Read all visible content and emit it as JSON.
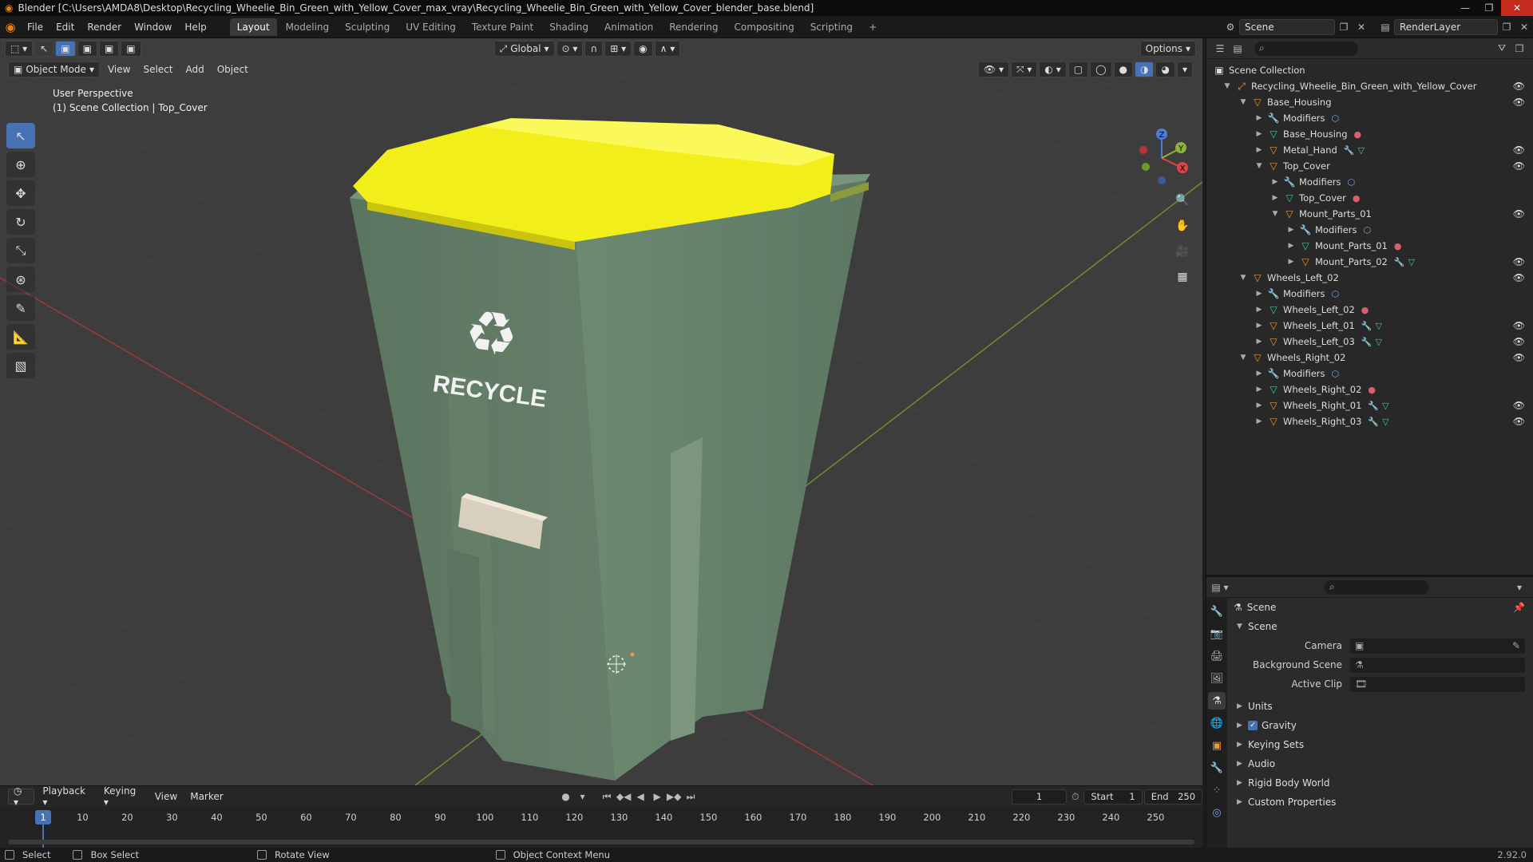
{
  "window": {
    "title": "Blender [C:\\Users\\AMDA8\\Desktop\\Recycling_Wheelie_Bin_Green_with_Yellow_Cover_max_vray\\Recycling_Wheelie_Bin_Green_with_Yellow_Cover_blender_base.blend]"
  },
  "menu": [
    "File",
    "Edit",
    "Render",
    "Window",
    "Help"
  ],
  "workspaces": [
    "Layout",
    "Modeling",
    "Sculpting",
    "UV Editing",
    "Texture Paint",
    "Shading",
    "Animation",
    "Rendering",
    "Compositing",
    "Scripting"
  ],
  "active_workspace": "Layout",
  "scene_name": "Scene",
  "render_layer": "RenderLayer",
  "viewport": {
    "mode": "Object Mode",
    "menus": [
      "View",
      "Select",
      "Add",
      "Object"
    ],
    "transform_orientation": "Global",
    "options_label": "Options",
    "info_line1": "User Perspective",
    "info_line2": "(1) Scene Collection | Top_Cover",
    "recycle_text": "RECYCLE"
  },
  "gizmo": {
    "x": "X",
    "y": "Y",
    "z": "Z"
  },
  "outliner": {
    "root": "Scene Collection",
    "rows": [
      {
        "label": "Recycling_Wheelie_Bin_Green_with_Yellow_Cover"
      },
      {
        "label": "Base_Housing"
      },
      {
        "label": "Modifiers"
      },
      {
        "label": "Base_Housing"
      },
      {
        "label": "Metal_Hand"
      },
      {
        "label": "Top_Cover"
      },
      {
        "label": "Modifiers"
      },
      {
        "label": "Top_Cover"
      },
      {
        "label": "Mount_Parts_01"
      },
      {
        "label": "Modifiers"
      },
      {
        "label": "Mount_Parts_01"
      },
      {
        "label": "Mount_Parts_02"
      },
      {
        "label": "Wheels_Left_02"
      },
      {
        "label": "Modifiers"
      },
      {
        "label": "Wheels_Left_02"
      },
      {
        "label": "Wheels_Left_01"
      },
      {
        "label": "Wheels_Left_03"
      },
      {
        "label": "Wheels_Right_02"
      },
      {
        "label": "Modifiers"
      },
      {
        "label": "Wheels_Right_02"
      },
      {
        "label": "Wheels_Right_01"
      },
      {
        "label": "Wheels_Right_03"
      }
    ]
  },
  "properties": {
    "breadcrumb": "Scene",
    "panel_title": "Scene",
    "camera_label": "Camera",
    "background_scene_label": "Background Scene",
    "active_clip_label": "Active Clip",
    "panels": [
      "Units",
      "Gravity",
      "Keying Sets",
      "Audio",
      "Rigid Body World",
      "Custom Properties"
    ]
  },
  "timeline": {
    "menus": [
      "Playback",
      "Keying",
      "View",
      "Marker"
    ],
    "current_frame": "1",
    "start_label": "Start",
    "start_value": "1",
    "end_label": "End",
    "end_value": "250",
    "ticks": [
      "10",
      "20",
      "30",
      "40",
      "50",
      "60",
      "70",
      "80",
      "90",
      "100",
      "110",
      "120",
      "130",
      "140",
      "150",
      "160",
      "170",
      "180",
      "190",
      "200",
      "210",
      "220",
      "230",
      "240",
      "250"
    ]
  },
  "statusbar": {
    "select": "Select",
    "box_select": "Box Select",
    "rotate_view": "Rotate View",
    "context_menu": "Object Context Menu",
    "version": "2.92.0"
  }
}
